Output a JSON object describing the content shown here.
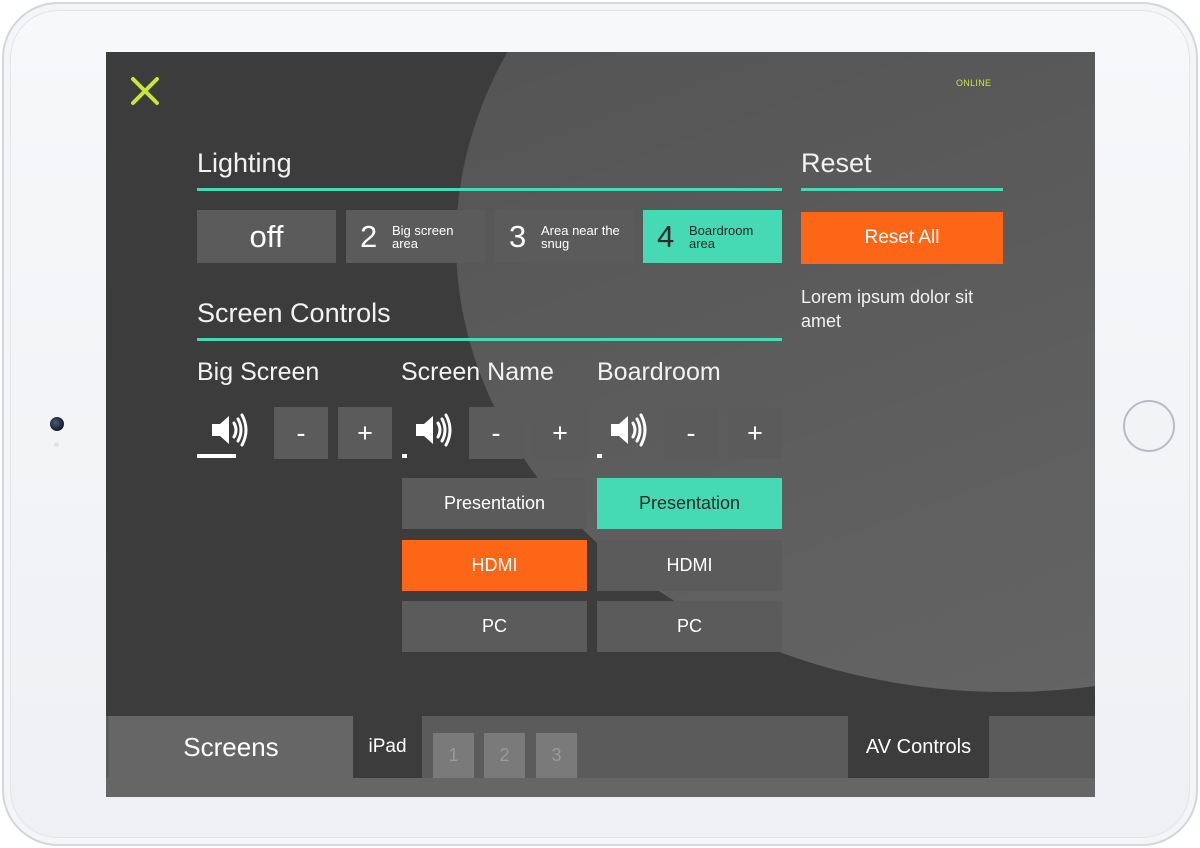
{
  "status": {
    "text": "ONLINE",
    "color": "#c8e63a"
  },
  "accent_colors": {
    "green": "#45d9b4",
    "orange": "#fd6617",
    "close": "#c8e63a"
  },
  "lighting": {
    "title": "Lighting",
    "off_label": "off",
    "scenes": [
      {
        "number": "2",
        "label": "Big screen area"
      },
      {
        "number": "3",
        "label": "Area near the snug"
      },
      {
        "number": "4",
        "label": "Boardroom area",
        "selected": true
      }
    ]
  },
  "reset": {
    "title": "Reset",
    "button_label": "Reset All",
    "description": "Lorem ipsum dolor sit amet"
  },
  "screen_controls": {
    "title": "Screen Controls",
    "zones": [
      {
        "name": "Big Screen",
        "volume_minus": "-",
        "volume_plus": "+"
      },
      {
        "name": "Screen Name",
        "volume_minus": "-",
        "volume_plus": "+",
        "sources": [
          "Presentation",
          "HDMI",
          "PC"
        ],
        "active_source": "HDMI"
      },
      {
        "name": "Boardroom",
        "volume_minus": "-",
        "volume_plus": "+",
        "sources": [
          "Presentation",
          "HDMI",
          "PC"
        ],
        "active_source": "Presentation"
      }
    ]
  },
  "bottom_nav": {
    "screens_tab": "Screens",
    "ipad_tab": "iPad",
    "pages": [
      "1",
      "2",
      "3"
    ],
    "av_controls_tab": "AV Controls"
  },
  "icons": [
    "close-icon",
    "speaker-icon"
  ]
}
